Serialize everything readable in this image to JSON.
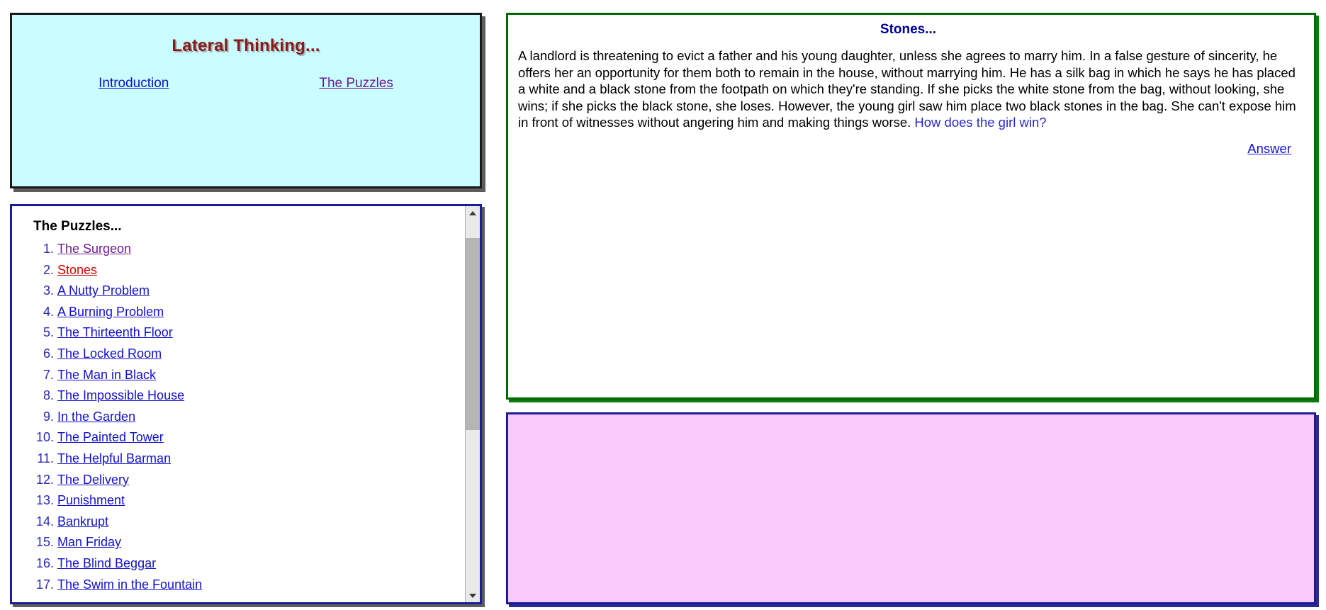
{
  "title_frame": {
    "heading": "Lateral Thinking...",
    "nav": [
      {
        "label": "Introduction",
        "state": "unvisited"
      },
      {
        "label": "The Puzzles",
        "state": "visited"
      }
    ],
    "background_color": "#c9fdff",
    "heading_color": "#8b1a1a"
  },
  "list_frame": {
    "heading": "The Puzzles...",
    "border_color": "#1c1c9a",
    "items": [
      {
        "n": "1.",
        "label": "The Surgeon",
        "state": "visited"
      },
      {
        "n": "2.",
        "label": "Stones",
        "state": "active"
      },
      {
        "n": "3.",
        "label": "A Nutty Problem",
        "state": "unvisited"
      },
      {
        "n": "4.",
        "label": "A Burning Problem",
        "state": "unvisited"
      },
      {
        "n": "5.",
        "label": "The Thirteenth Floor",
        "state": "unvisited"
      },
      {
        "n": "6.",
        "label": "The Locked Room",
        "state": "unvisited"
      },
      {
        "n": "7.",
        "label": "The Man in Black",
        "state": "unvisited"
      },
      {
        "n": "8.",
        "label": "The Impossible House",
        "state": "unvisited"
      },
      {
        "n": "9.",
        "label": "In the Garden",
        "state": "unvisited"
      },
      {
        "n": "10.",
        "label": "The Painted Tower",
        "state": "unvisited"
      },
      {
        "n": "11.",
        "label": "The Helpful Barman",
        "state": "unvisited"
      },
      {
        "n": "12.",
        "label": "The Delivery",
        "state": "unvisited"
      },
      {
        "n": "13.",
        "label": "Punishment",
        "state": "unvisited"
      },
      {
        "n": "14.",
        "label": "Bankrupt",
        "state": "unvisited"
      },
      {
        "n": "15.",
        "label": "Man Friday",
        "state": "unvisited"
      },
      {
        "n": "16.",
        "label": "The Blind Beggar",
        "state": "unvisited"
      },
      {
        "n": "17.",
        "label": "The Swim in the Fountain",
        "state": "unvisited"
      }
    ],
    "scrollbar": {
      "up_icon": "chevron-up-icon",
      "down_icon": "chevron-down-icon",
      "thumb_top_pct": 5,
      "thumb_height_pct": 52
    }
  },
  "puzzle_frame": {
    "heading": "Stones...",
    "border_color": "#006a00",
    "body_text": "A landlord is threatening to evict a father and his young daughter, unless she agrees to marry him. In a false gesture of sincerity, he offers her an opportunity for them both to remain in the house, without marrying him. He has a silk bag in which he says he has placed a white and a black stone from the footpath on which they're standing. If she picks the white stone from the bag, without looking, she wins; if she picks the black stone, she loses. However, the young girl saw him place two black stones in the bag. She can't expose him in front of witnesses without angering him and making things worse. ",
    "question_text": "How does the girl win?",
    "answer_link": "Answer"
  },
  "answer_frame": {
    "background_color": "#fac9fc",
    "border_color": "#1c1c9a",
    "content": ""
  }
}
